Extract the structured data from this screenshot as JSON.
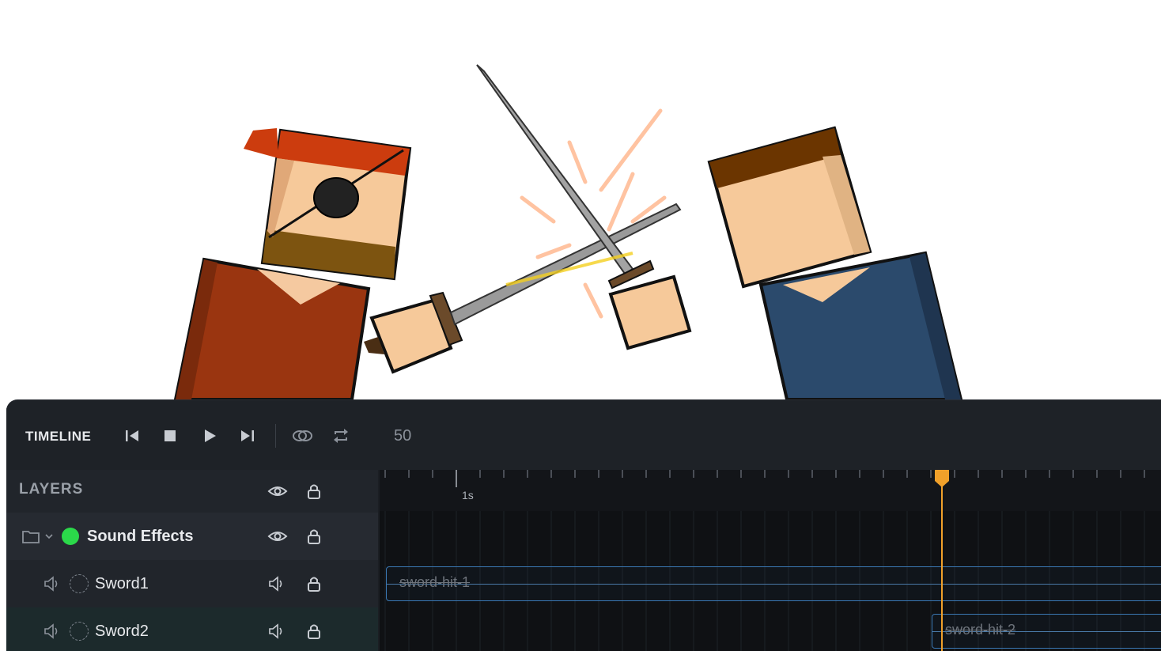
{
  "timeline": {
    "title": "TIMELINE",
    "current_frame": "50",
    "controls": [
      "skip-to-start",
      "stop",
      "play",
      "skip-to-end",
      "onion-skin",
      "loop"
    ]
  },
  "layers": {
    "header": "LAYERS",
    "rows": [
      {
        "label": "Sound Effects",
        "type": "group",
        "status": "active"
      },
      {
        "label": "Sword1",
        "type": "audio"
      },
      {
        "label": "Sword2",
        "type": "audio"
      }
    ]
  },
  "ruler": {
    "label": "1s"
  },
  "clips": [
    {
      "label": "sword-hit-1"
    },
    {
      "label": "sword-hit-2"
    }
  ],
  "colors": {
    "accent_playhead": "#f0a02a",
    "clip_border": "#3a78b4",
    "status_green": "#2bd94a",
    "panel_bg": "#1b1e23"
  }
}
